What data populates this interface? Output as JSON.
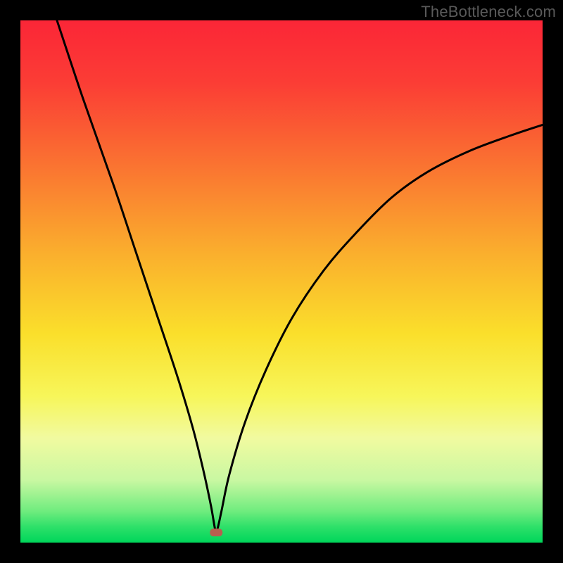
{
  "watermark": "TheBottleneck.com",
  "chart_data": {
    "type": "line",
    "title": "",
    "xlabel": "",
    "ylabel": "",
    "xlim": [
      0,
      100
    ],
    "ylim": [
      0,
      100
    ],
    "grid": false,
    "legend": false,
    "background": {
      "type": "vertical-gradient",
      "description": "red at top through orange and yellow to green at bottom",
      "stops": [
        {
          "offset": 0,
          "color": "#fb2637"
        },
        {
          "offset": 25,
          "color": "#fa7431"
        },
        {
          "offset": 50,
          "color": "#fac82c"
        },
        {
          "offset": 72,
          "color": "#f7f満"
        },
        {
          "offset": 78,
          "color": "#f3f9a2"
        },
        {
          "offset": 95,
          "color": "#3ae36c"
        },
        {
          "offset": 100,
          "color": "#00d65a"
        }
      ]
    },
    "series": [
      {
        "name": "bottleneck-curve",
        "color": "#000000",
        "x": [
          7,
          12,
          18,
          22,
          26,
          30,
          33,
          35,
          36.5,
          37.3,
          37.7,
          38.5,
          40,
          43,
          47,
          52,
          58,
          64,
          71,
          78,
          86,
          94,
          100
        ],
        "y": [
          100,
          85,
          68,
          56,
          44,
          32,
          22,
          14,
          7,
          2.5,
          2.5,
          6,
          13,
          23,
          33,
          43,
          52,
          59,
          66,
          71,
          75,
          78,
          80
        ]
      }
    ],
    "marker": {
      "name": "vertex-marker",
      "x": 37.5,
      "y": 2,
      "color": "#b7604f",
      "shape": "rounded-rect"
    }
  }
}
